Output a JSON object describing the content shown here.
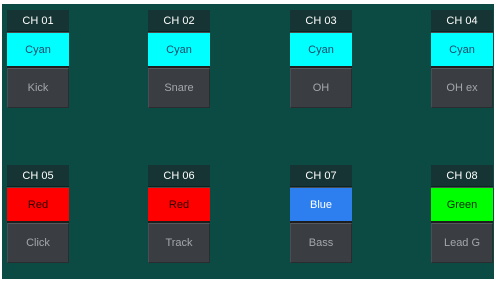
{
  "channels": [
    {
      "id": "CH 01",
      "color_label": "Cyan",
      "color_hex": "#00ffff",
      "text_color": "#1a4a6a",
      "name": "Kick"
    },
    {
      "id": "CH 02",
      "color_label": "Cyan",
      "color_hex": "#00ffff",
      "text_color": "#1a4a6a",
      "name": "Snare"
    },
    {
      "id": "CH 03",
      "color_label": "Cyan",
      "color_hex": "#00ffff",
      "text_color": "#1a4a6a",
      "name": "OH"
    },
    {
      "id": "CH 04",
      "color_label": "Cyan",
      "color_hex": "#00ffff",
      "text_color": "#1a4a6a",
      "name": "OH ex"
    },
    {
      "id": "CH 05",
      "color_label": "Red",
      "color_hex": "#ff0000",
      "text_color": "#2a0000",
      "name": "Click"
    },
    {
      "id": "CH 06",
      "color_label": "Red",
      "color_hex": "#ff0000",
      "text_color": "#2a0000",
      "name": "Track"
    },
    {
      "id": "CH 07",
      "color_label": "Blue",
      "color_hex": "#2d7ff0",
      "text_color": "#ffffff",
      "name": "Bass"
    },
    {
      "id": "CH 08",
      "color_label": "Green",
      "color_hex": "#00ff00",
      "text_color": "#0a2a0a",
      "name": "Lead G"
    }
  ],
  "colors": {
    "background": "#0c4a44",
    "header": "#153433",
    "name_button": "#3a3d42"
  }
}
